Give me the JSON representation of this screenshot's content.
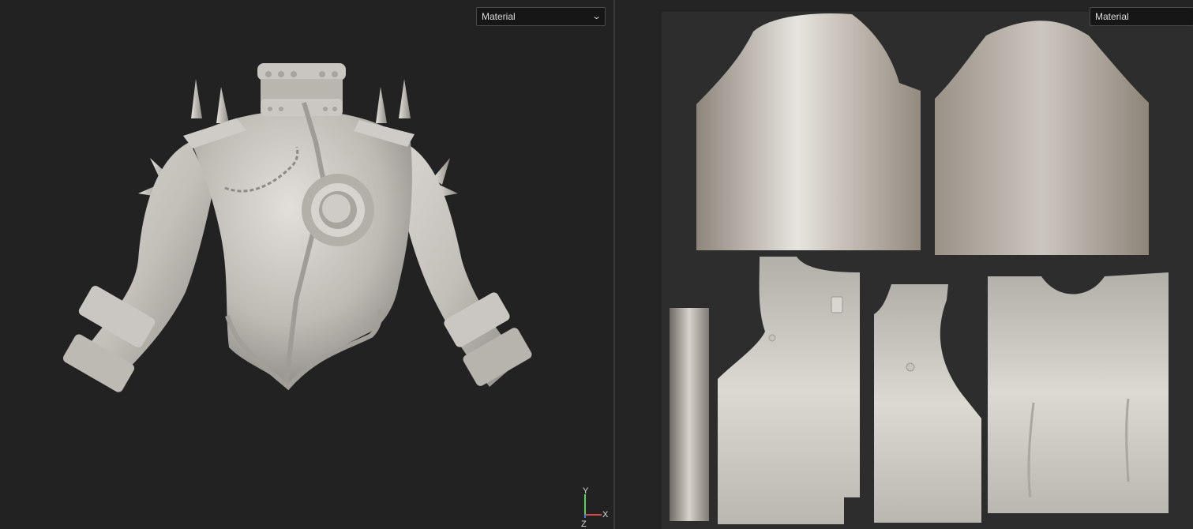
{
  "viewport_3d": {
    "material_dropdown": {
      "selected": "Material"
    },
    "axis_gizmo": {
      "y_label": "Y",
      "x_label": "X",
      "z_label": "Z"
    }
  },
  "viewport_uv": {
    "material_dropdown": {
      "selected": "Material"
    }
  },
  "colors": {
    "background": "#222222",
    "uv_frame": "#2d2d2d",
    "mesh_base": "#bdb9b3",
    "axis_x": "#d94a4a",
    "axis_y": "#5fcf5f",
    "axis_z": "#4a7ee0"
  },
  "icons": {
    "dropdown": "chevron-down-icon",
    "gizmo": "axis-gizmo-icon"
  }
}
